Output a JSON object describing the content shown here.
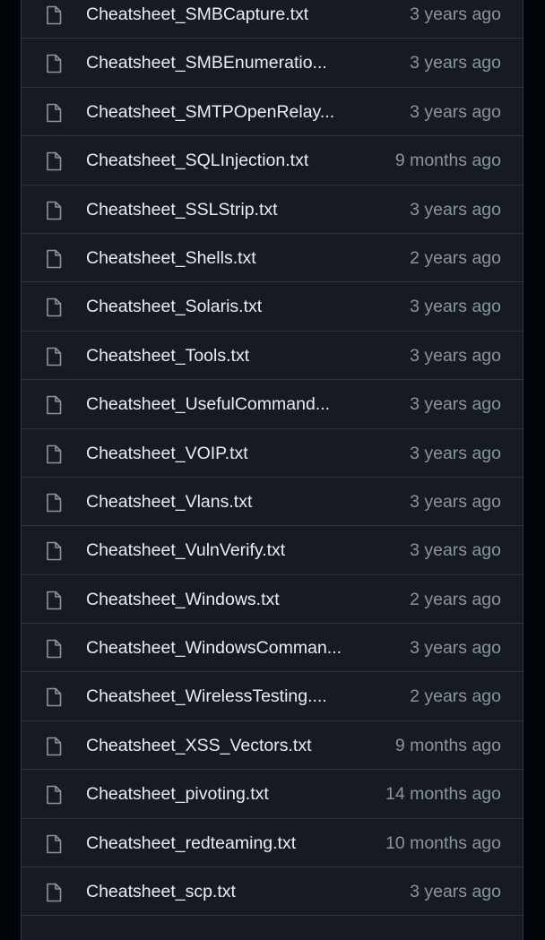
{
  "files": [
    {
      "name": "Cheatsheet_SMBCapture.txt",
      "age": "3 years ago",
      "icon": "file-icon"
    },
    {
      "name": "Cheatsheet_SMBEnumeratio...",
      "age": "3 years ago",
      "icon": "file-icon"
    },
    {
      "name": "Cheatsheet_SMTPOpenRelay...",
      "age": "3 years ago",
      "icon": "file-icon"
    },
    {
      "name": "Cheatsheet_SQLInjection.txt",
      "age": "9 months ago",
      "icon": "file-icon"
    },
    {
      "name": "Cheatsheet_SSLStrip.txt",
      "age": "3 years ago",
      "icon": "file-icon"
    },
    {
      "name": "Cheatsheet_Shells.txt",
      "age": "2 years ago",
      "icon": "file-icon"
    },
    {
      "name": "Cheatsheet_Solaris.txt",
      "age": "3 years ago",
      "icon": "file-icon"
    },
    {
      "name": "Cheatsheet_Tools.txt",
      "age": "3 years ago",
      "icon": "file-icon"
    },
    {
      "name": "Cheatsheet_UsefulCommand...",
      "age": "3 years ago",
      "icon": "file-icon"
    },
    {
      "name": "Cheatsheet_VOIP.txt",
      "age": "3 years ago",
      "icon": "file-icon"
    },
    {
      "name": "Cheatsheet_Vlans.txt",
      "age": "3 years ago",
      "icon": "file-icon"
    },
    {
      "name": "Cheatsheet_VulnVerify.txt",
      "age": "3 years ago",
      "icon": "file-icon"
    },
    {
      "name": "Cheatsheet_Windows.txt",
      "age": "2 years ago",
      "icon": "file-icon"
    },
    {
      "name": "Cheatsheet_WindowsComman...",
      "age": "3 years ago",
      "icon": "file-icon"
    },
    {
      "name": "Cheatsheet_WirelessTesting....",
      "age": "2 years ago",
      "icon": "file-icon"
    },
    {
      "name": "Cheatsheet_XSS_Vectors.txt",
      "age": "9 months ago",
      "icon": "file-icon"
    },
    {
      "name": "Cheatsheet_pivoting.txt",
      "age": "14 months ago",
      "icon": "file-icon"
    },
    {
      "name": "Cheatsheet_redteaming.txt",
      "age": "10 months ago",
      "icon": "file-icon"
    },
    {
      "name": "Cheatsheet_scp.txt",
      "age": "3 years ago",
      "icon": "file-icon"
    }
  ],
  "colors": {
    "page_background": "#010409",
    "list_background": "#161b22",
    "border": "#30363d",
    "file_name": "#e6edf3",
    "muted_text": "#8b949e"
  }
}
